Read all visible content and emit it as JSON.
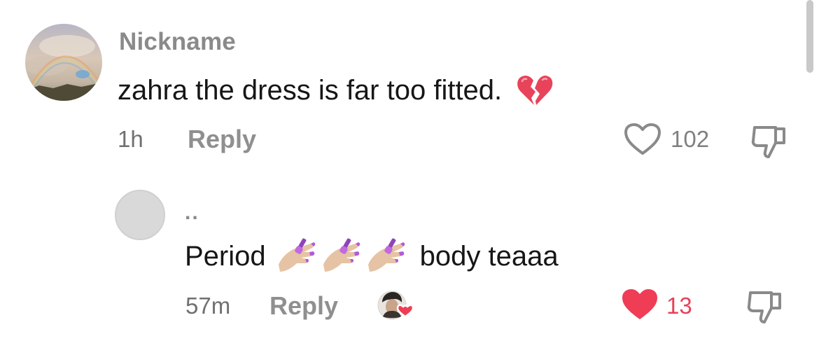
{
  "comments": [
    {
      "nickname": "Nickname",
      "text": "zahra the dress is far too fitted.",
      "emoji_icon": "broken-heart-icon",
      "time": "1h",
      "reply_label": "Reply",
      "like_count": "102",
      "liked": false
    },
    {
      "nickname": "..",
      "text_before": "Period",
      "emoji_icons": [
        "nail-polish-icon",
        "nail-polish-icon",
        "nail-polish-icon"
      ],
      "text_after": "body teaaa",
      "time": "57m",
      "reply_label": "Reply",
      "like_count": "13",
      "liked": true,
      "creator_liked_icon": "creator-liked-heart-icon"
    }
  ],
  "colors": {
    "like_active": "#ee3d55",
    "muted_text": "#8a8a8a",
    "primary_text": "#161616"
  }
}
